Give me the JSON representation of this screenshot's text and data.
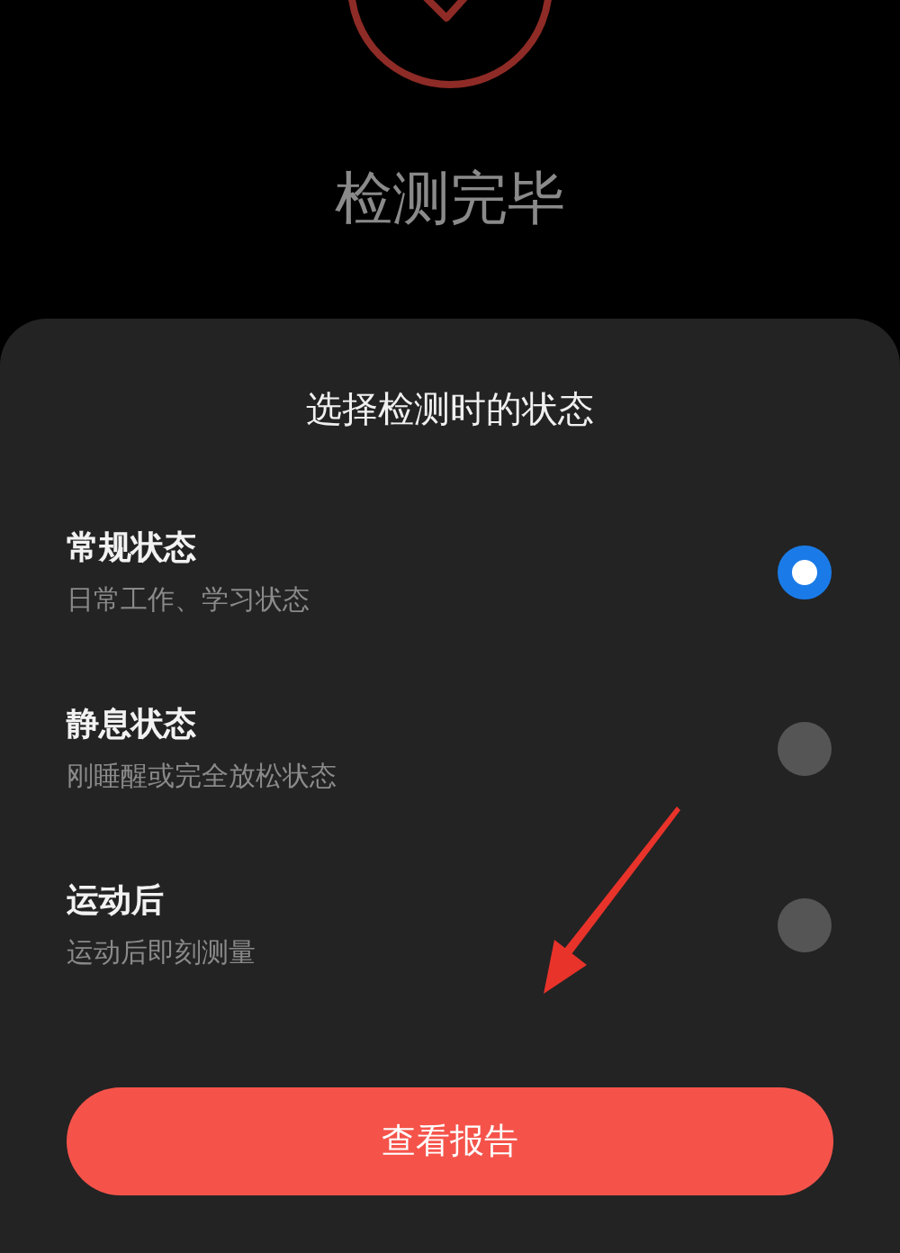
{
  "header": {
    "title": "检测完毕"
  },
  "sheet": {
    "title": "选择检测时的状态",
    "options": [
      {
        "label": "常规状态",
        "description": "日常工作、学习状态",
        "selected": true
      },
      {
        "label": "静息状态",
        "description": "刚睡醒或完全放松状态",
        "selected": false
      },
      {
        "label": "运动后",
        "description": "运动后即刻测量",
        "selected": false
      }
    ],
    "button": "查看报告"
  }
}
